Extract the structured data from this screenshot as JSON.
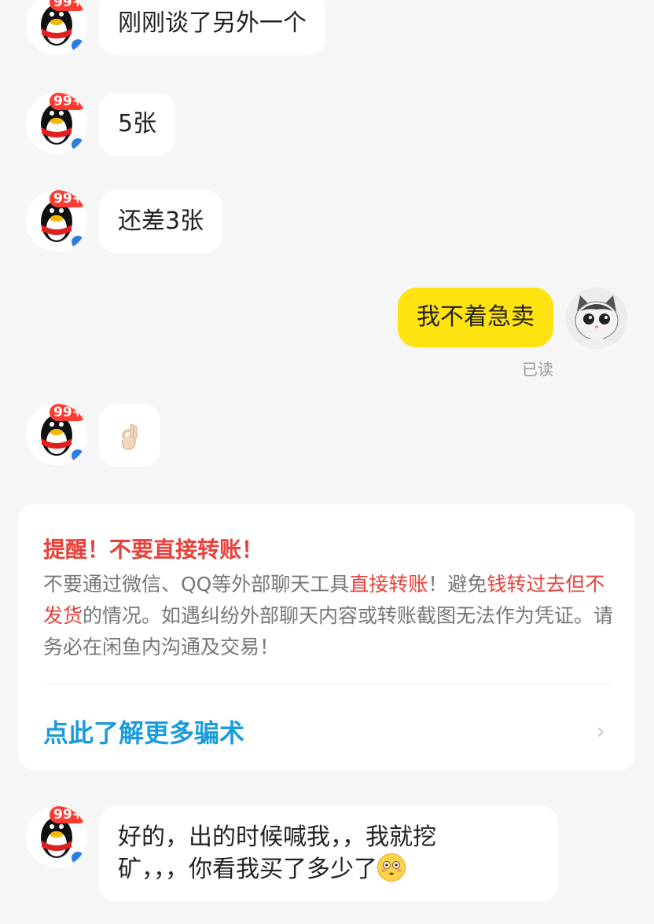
{
  "messages": [
    {
      "side": "left",
      "text": "刚刚谈了另外一个",
      "badge": "99+"
    },
    {
      "side": "left",
      "text": "5张",
      "badge": "99+"
    },
    {
      "side": "left",
      "text": "还差3张",
      "badge": "99+"
    },
    {
      "side": "right",
      "text": "我不着急卖",
      "status": "已读"
    },
    {
      "side": "left",
      "emoji": "ok-hand-emoji",
      "badge": "99+"
    },
    {
      "side": "left",
      "line1": "好的，出的时候喊我，，我就挖",
      "line2": "矿，，，你看我买了多少了",
      "emoji": "flushed-face-emoji",
      "badge": "99+"
    }
  ],
  "warning": {
    "title": "提醒！不要直接转账！",
    "body_part1": "不要通过微信、QQ等外部聊天工具",
    "body_hl1": "直接转账",
    "body_part2": "！避免",
    "body_hl2": "钱转过去但不发货",
    "body_part3": "的情况。如遇纠纷外部聊天内容或转账截图无法作为凭证。请务必在闲鱼内沟通及交易！",
    "link": "点此了解更多骗术",
    "chevron_icon": "chevron-right-icon"
  },
  "colors": {
    "background": "#f6f6f6",
    "self_bubble": "#ffe310",
    "warning_red": "#e8403a",
    "link_blue": "#1a9bdb",
    "badge_red": "#ff3b30"
  }
}
